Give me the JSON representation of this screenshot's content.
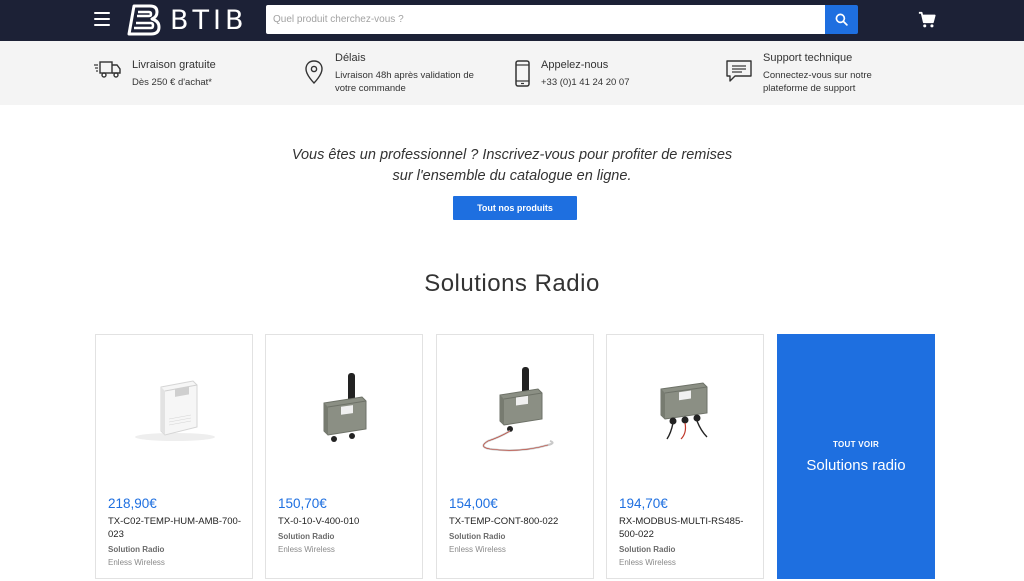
{
  "header": {
    "logo_text": "BTIB",
    "search_placeholder": "Quel produit cherchez-vous ?"
  },
  "infobar": [
    {
      "title": "Livraison gratuite",
      "desc": "Dès 250 € d'achat*",
      "icon": "delivery-truck-icon"
    },
    {
      "title": "Délais",
      "desc": "Livraison 48h après validation de votre commande",
      "icon": "location-pin-icon"
    },
    {
      "title": "Appelez-nous",
      "desc": "+33 (0)1 41 24 20 07",
      "icon": "phone-icon"
    },
    {
      "title": "Support technique",
      "desc": "Connectez-vous sur notre plateforme de support",
      "icon": "chat-support-icon"
    }
  ],
  "promo": {
    "line1": "Vous êtes un professionnel ? Inscrivez-vous pour profiter de remises",
    "line2": "sur l'ensemble du catalogue en ligne.",
    "cta": "Tout nos produits"
  },
  "section_title": "Solutions Radio",
  "products": [
    {
      "price": "218,90€",
      "name": "TX-C02-TEMP-HUM-AMB-700-023",
      "category": "Solution Radio",
      "brand": "Enless Wireless"
    },
    {
      "price": "150,70€",
      "name": "TX-0-10-V-400-010",
      "category": "Solution Radio",
      "brand": "Enless Wireless"
    },
    {
      "price": "154,00€",
      "name": "TX-TEMP-CONT-800-022",
      "category": "Solution Radio",
      "brand": "Enless Wireless"
    },
    {
      "price": "194,70€",
      "name": "RX-MODBUS-MULTI-RS485-500-022",
      "category": "Solution Radio",
      "brand": "Enless Wireless"
    }
  ],
  "see_all": {
    "kicker": "TOUT VOIR",
    "title": "Solutions radio"
  },
  "colors": {
    "header_bg": "#1c2136",
    "accent": "#1e6fe0",
    "infobar_bg": "#f4f4f4"
  }
}
